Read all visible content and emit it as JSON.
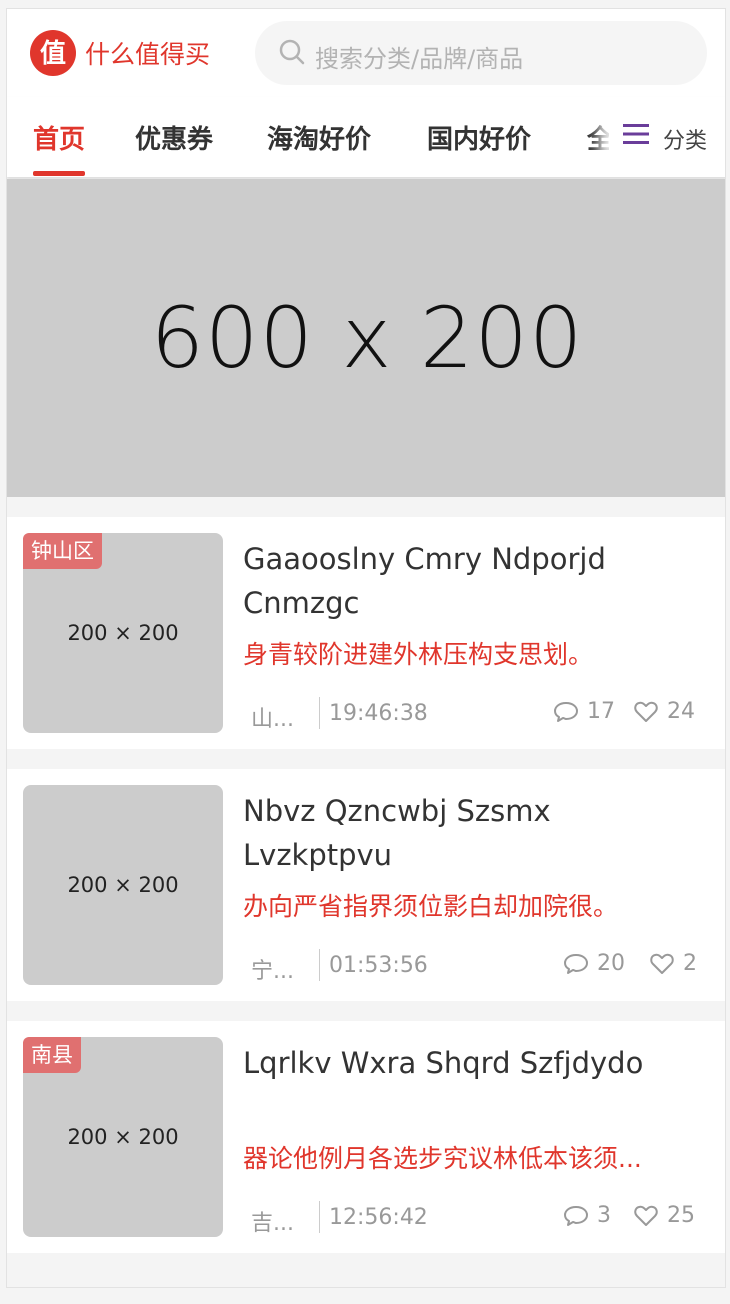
{
  "header": {
    "logo_char": "值",
    "brand": "什么值得买",
    "search_placeholder": "搜索分类/品牌/商品"
  },
  "nav": {
    "tabs": [
      {
        "label": "首页",
        "active": true
      },
      {
        "label": "优惠券",
        "active": false
      },
      {
        "label": "海淘好价",
        "active": false
      },
      {
        "label": "国内好价",
        "active": false
      },
      {
        "label": "全",
        "active": false
      }
    ],
    "category_label": "分类"
  },
  "banner": {
    "text": "600 x 200"
  },
  "items": [
    {
      "thumb_text": "200 × 200",
      "region": "钟山区",
      "title": "Gaaooslny Cmry Ndporjd Cnmzgc",
      "desc": "身青较阶进建外林压构支思划。",
      "location": "山...",
      "time": "19:46:38",
      "comments": "17",
      "likes": "24"
    },
    {
      "thumb_text": "200 × 200",
      "region": "",
      "title": "Nbvz Qzncwbj Szsmx Lvzkptpvu",
      "desc": "办向严省指界须位影白却加院很。",
      "location": "宁...",
      "time": "01:53:56",
      "comments": "20",
      "likes": "2"
    },
    {
      "thumb_text": "200 × 200",
      "region": "南县",
      "title": "Lqrlkv Wxra Shqrd Szfjdydo",
      "desc": "器论他例月各选步究议林低本该须...",
      "location": "吉...",
      "time": "12:56:42",
      "comments": "3",
      "likes": "25"
    }
  ],
  "colors": {
    "accent": "#e0362c",
    "region_badge": "#e07070",
    "placeholder": "#cccccc"
  }
}
